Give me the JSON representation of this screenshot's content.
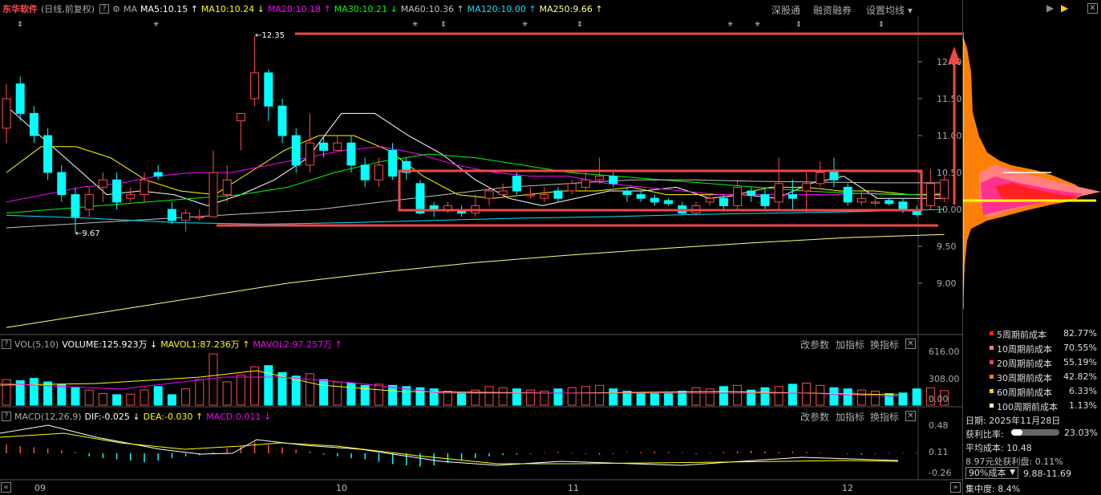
{
  "header": {
    "stock_name": "东华软件",
    "period": "(日线,前复权)",
    "ma_label": "MA",
    "ma": [
      {
        "label": "MA5:10.15",
        "arrow": "↑",
        "color": "#ffffff"
      },
      {
        "label": "MA10:10.24",
        "arrow": "↓",
        "color": "#ffff00"
      },
      {
        "label": "MA20:10.18",
        "arrow": "↑",
        "color": "#ff00ff"
      },
      {
        "label": "MA30:10.21",
        "arrow": "↓",
        "color": "#00ff00"
      },
      {
        "label": "MA60:10.36",
        "arrow": "↑",
        "color": "#c0c0c0"
      },
      {
        "label": "MA120:10.00",
        "arrow": "↑",
        "color": "#00e5ff"
      },
      {
        "label": "MA250:9.66",
        "arrow": "↑",
        "color": "#ffff80"
      }
    ],
    "buttons": {
      "sgt": "深股通",
      "rzrq": "融资融券",
      "szjx": "设置均线 ▾"
    }
  },
  "price_axis": [
    "12.00",
    "11.50",
    "11.00",
    "10.50",
    "10.00",
    "9.50",
    "9.00"
  ],
  "annotations": {
    "high": "12.35",
    "low": "9.67"
  },
  "volume": {
    "title": "VOL(5,10)",
    "volume": "VOLUME:125.923万",
    "vol_arrow": "↓",
    "mavol1": "MAVOL1:87.236万",
    "mavol1_arrow": "↑",
    "mavol2": "MAVOL2:97.257万",
    "mavol2_arrow": "↑",
    "axis": [
      "616.00",
      "308.00",
      "0.00"
    ]
  },
  "macd": {
    "title": "MACD(12,26,9)",
    "dif": "DIF:-0.025",
    "dif_arrow": "↓",
    "dea": "DEA:-0.030",
    "dea_arrow": "↑",
    "macd": "MACD:0.011",
    "macd_arrow": "↓",
    "axis": [
      "0.48",
      "0.11",
      "-0.26"
    ]
  },
  "panel_buttons": {
    "params": "改参数",
    "add": "加指标",
    "switch": "换指标",
    "close": "✕"
  },
  "xaxis": {
    "nav_left": "«",
    "nav_right": "»",
    "labels": [
      "09",
      "10",
      "11",
      "12"
    ]
  },
  "right_panel": {
    "controls": [
      "▶",
      "▶",
      "✕"
    ],
    "legend": [
      {
        "label": "5周期前成本",
        "pct": "82.77%",
        "color": "#ff2020"
      },
      {
        "label": "10周期前成本",
        "pct": "70.55%",
        "color": "#ff8080"
      },
      {
        "label": "20周期前成本",
        "pct": "55.19%",
        "color": "#ff3090"
      },
      {
        "label": "30周期前成本",
        "pct": "42.82%",
        "color": "#ff8000"
      },
      {
        "label": "60周期前成本",
        "pct": "6.33%",
        "color": "#ffd000"
      },
      {
        "label": "100周期前成本",
        "pct": "1.13%",
        "color": "#ffffa0"
      }
    ],
    "date": "日期: 2025年11月28日",
    "profit_label": "获利比率:",
    "profit_pct": "23.03%",
    "profit_fill": 0.23,
    "avg_cost": "平均成本: 10.48",
    "profit_at": "8.97元处获利盘: 0.11%",
    "cost_select": "90%成本",
    "cost_range": "9.88-11.69",
    "concentration": "集中度: 8.4%"
  }
}
